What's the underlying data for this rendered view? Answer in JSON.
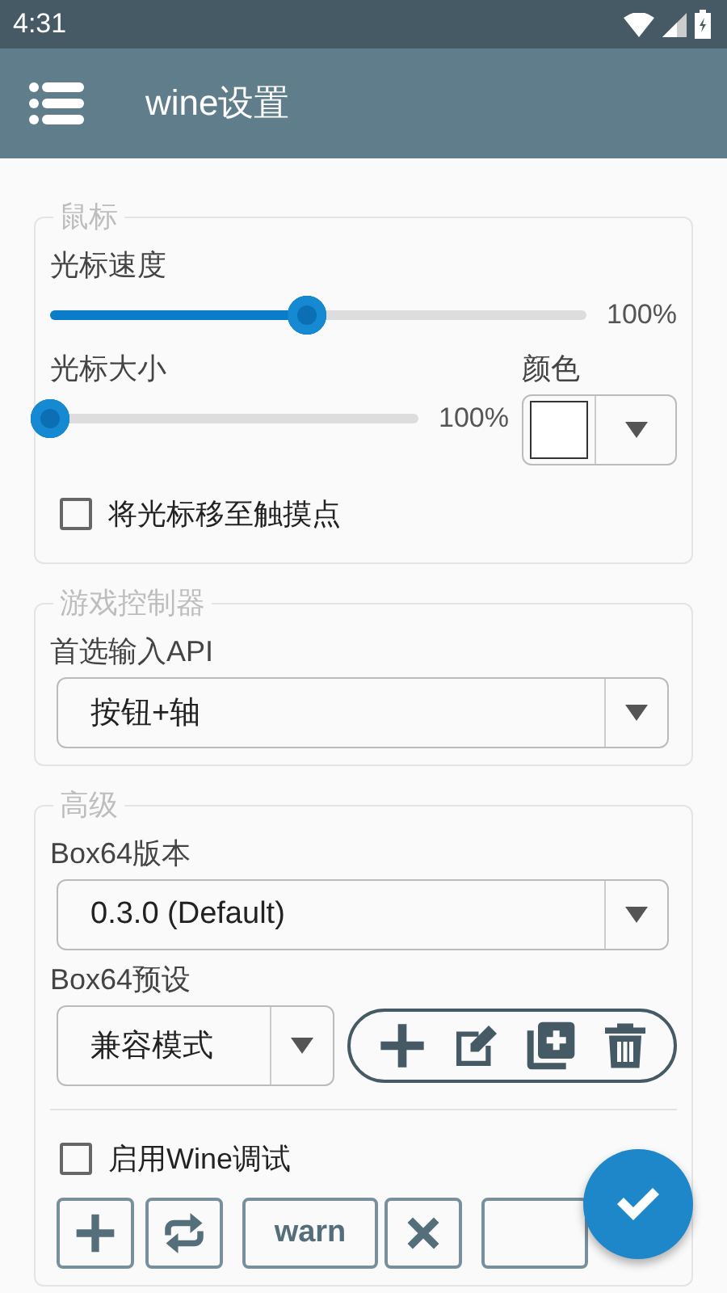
{
  "status_bar": {
    "time": "4:31"
  },
  "app_bar": {
    "title": "wine设置"
  },
  "sections": [
    {
      "legend": "鼠标",
      "items": [
        {
          "kind": "slider",
          "label": "光标速度",
          "level": 0.48,
          "reading": "100%"
        },
        {
          "kind": "slider_color",
          "label": "光标大小",
          "level": 0,
          "reading": "100%",
          "color_label": "颜色",
          "color": "#ffffff"
        },
        {
          "kind": "checkbox",
          "label": "将光标移至触摸点",
          "checked": false
        }
      ]
    },
    {
      "legend": "游戏控制器",
      "items": [
        {
          "kind": "dropdown",
          "label": "首选输入API",
          "value": "按钮+轴"
        }
      ]
    },
    {
      "legend": "高级",
      "items": [
        {
          "kind": "dropdown",
          "label": "Box64版本",
          "value": "0.3.0 (Default)"
        },
        {
          "kind": "preset",
          "label": "Box64预设",
          "value": "兼容模式"
        },
        {
          "kind": "divider"
        },
        {
          "kind": "checkbox",
          "label": "启用Wine调试",
          "checked": false
        },
        {
          "kind": "debug_row",
          "channels": [
            {
              "label": "warn",
              "obscured": false
            },
            {
              "obscured": true
            }
          ]
        }
      ]
    }
  ]
}
